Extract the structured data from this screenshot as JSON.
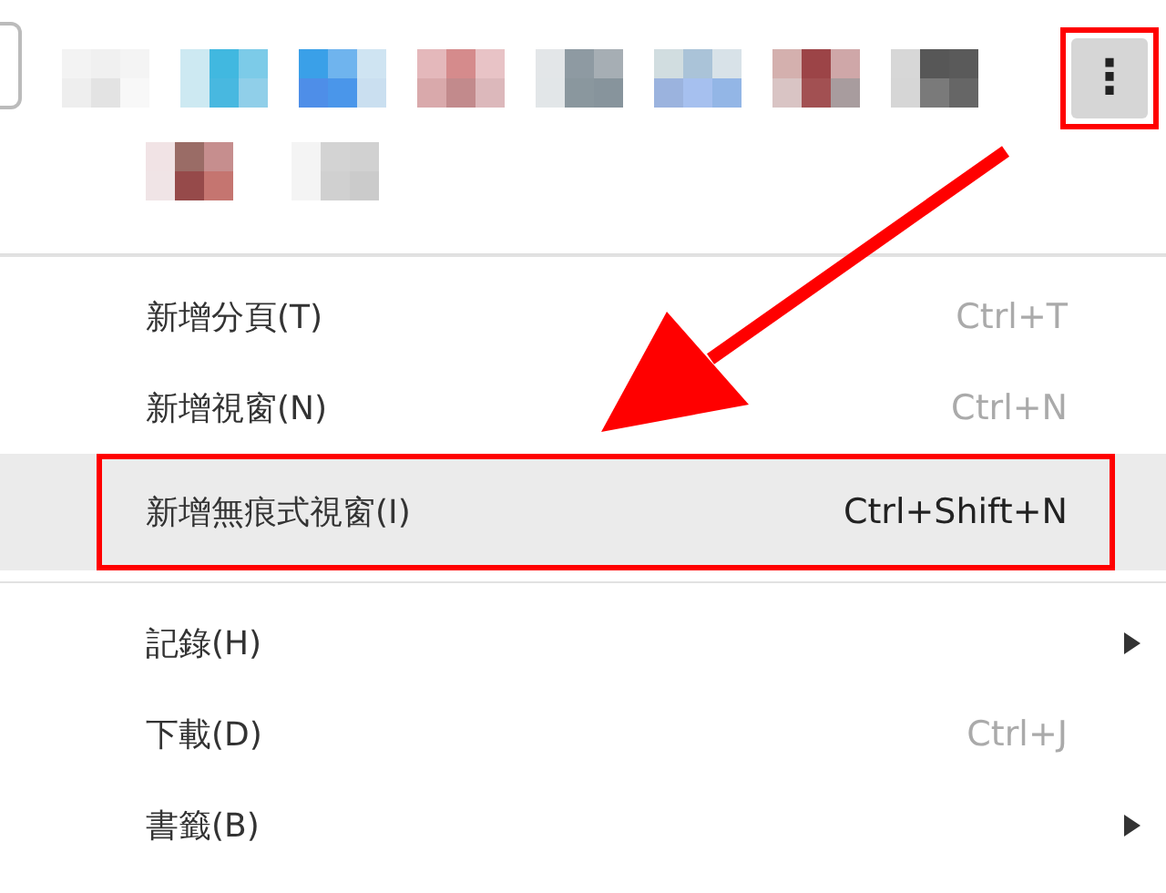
{
  "toolbar": {
    "menu_button": {
      "label": "⋮",
      "annotated": true
    }
  },
  "menu": {
    "items": [
      {
        "kind": "separator"
      },
      {
        "kind": "item",
        "label": "新增分頁(T)",
        "shortcut": "Ctrl+T",
        "selected": false,
        "annotated": false,
        "submenu": false
      },
      {
        "kind": "item",
        "label": "新增視窗(N)",
        "shortcut": "Ctrl+N",
        "selected": false,
        "annotated": false,
        "submenu": false
      },
      {
        "kind": "item",
        "label": "新增無痕式視窗(I)",
        "shortcut": "Ctrl+Shift+N",
        "selected": true,
        "annotated": true,
        "submenu": false
      },
      {
        "kind": "separator"
      },
      {
        "kind": "item",
        "label": "記錄(H)",
        "selected": false,
        "annotated": false,
        "submenu": true
      },
      {
        "kind": "item",
        "label": "下載(D)",
        "shortcut": "Ctrl+J",
        "selected": false,
        "annotated": false,
        "submenu": false
      },
      {
        "kind": "item",
        "label": "書籤(B)",
        "selected": false,
        "annotated": false,
        "submenu": true
      }
    ]
  }
}
